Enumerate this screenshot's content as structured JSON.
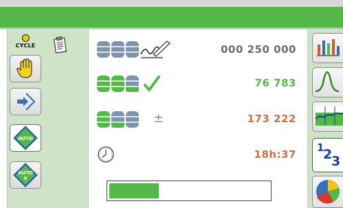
{
  "header": {
    "color": "#54b848"
  },
  "sidebar": {
    "cycle_label": "CYCLE",
    "buttons": [
      {
        "name": "manual",
        "icon": "hand-icon"
      },
      {
        "name": "step",
        "icon": "step-arrow-icon"
      },
      {
        "name": "auto",
        "icon": "auto-diamond-icon",
        "label": "AUTO",
        "active": true
      },
      {
        "name": "auto-ii",
        "icon": "auto-ii-diamond-icon",
        "label": "AUTO",
        "sublabel": "II"
      }
    ]
  },
  "counters": {
    "total": {
      "icon": "gray-stacks-signature-icon",
      "value": "000 250 000"
    },
    "good": {
      "icon": "green-stacks-check-icon",
      "value": "76 783"
    },
    "remaining": {
      "icon": "stacks-plus-minus-icon",
      "symbol": "±",
      "value": "173 222"
    },
    "time": {
      "icon": "clock-icon",
      "value": "18h:37"
    }
  },
  "progress": {
    "fraction": 0.31,
    "color": "#54b848"
  },
  "right_toolbar": {
    "items": [
      {
        "icon": "histogram-icon"
      },
      {
        "icon": "bell-curve-icon"
      },
      {
        "icon": "trend-chart-icon"
      },
      {
        "icon": "numbers-123-icon",
        "text": "1",
        "text2": "2",
        "text3": "3",
        "active": true
      },
      {
        "icon": "pie-chart-icon"
      }
    ]
  }
}
